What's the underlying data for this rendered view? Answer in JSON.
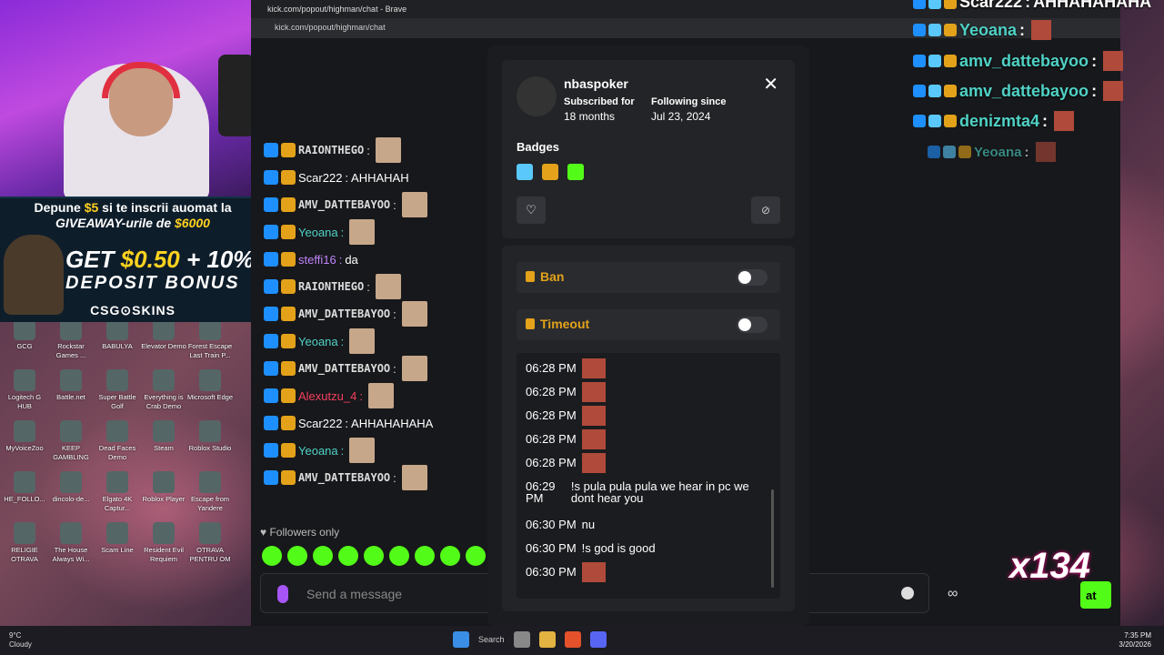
{
  "desktop": {
    "icons": [
      {
        "label": "GCG",
        "icon": "app-icon"
      },
      {
        "label": "Rockstar Games ...",
        "icon": "app-icon"
      },
      {
        "label": "BABULYA",
        "icon": "app-icon"
      },
      {
        "label": "Elevator Demo",
        "icon": "app-icon"
      },
      {
        "label": "Forest Escape Last Train P...",
        "icon": "app-icon"
      },
      {
        "label": "Logitech G HUB",
        "icon": "logitech-icon"
      },
      {
        "label": "Battle.net",
        "icon": "battlenet-icon"
      },
      {
        "label": "Super Battle Golf",
        "icon": "app-icon"
      },
      {
        "label": "Everything is Crab Demo",
        "icon": "app-icon"
      },
      {
        "label": "Microsoft Edge",
        "icon": "edge-icon"
      },
      {
        "label": "MyVoiceZoo",
        "icon": "app-icon"
      },
      {
        "label": "KEEP GAMBLING",
        "icon": "app-icon"
      },
      {
        "label": "Dead Faces Demo",
        "icon": "app-icon"
      },
      {
        "label": "Steam",
        "icon": "steam-icon"
      },
      {
        "label": "Roblox Studio",
        "icon": "roblox-icon"
      },
      {
        "label": "HE_FOLLO...",
        "icon": "folder-icon"
      },
      {
        "label": "dincolo-de...",
        "icon": "file-icon"
      },
      {
        "label": "Elgato 4K Captur...",
        "icon": "elgato-icon"
      },
      {
        "label": "Roblox Player",
        "icon": "roblox-icon"
      },
      {
        "label": "Escape from Yandere",
        "icon": "app-icon"
      },
      {
        "label": "RELIGIE OTRAVA",
        "icon": "file-icon"
      },
      {
        "label": "The House Always Wi...",
        "icon": "app-icon"
      },
      {
        "label": "Scam Line",
        "icon": "app-icon"
      },
      {
        "label": "Resident Evil Requiem",
        "icon": "app-icon"
      },
      {
        "label": "OTRAVA PENTRU OM",
        "icon": "file-icon"
      }
    ]
  },
  "promo": {
    "line1_pre": "Depune ",
    "line1_amt": "$5",
    "line1_post": " si te inscrii auomat la",
    "line2_pre": "GIVEAWAY-urile de ",
    "line2_amt": "$6000",
    "big1_pre": "GET ",
    "big1_amt": "$0.50",
    "big1_post": " + 10%",
    "big2": "DEPOSIT BONUS",
    "brand": "CSG⊙SKINS"
  },
  "browser": {
    "title": "kick.com/popout/highman/chat - Brave",
    "url": "kick.com/popout/highman/chat"
  },
  "chat": {
    "messages": [
      {
        "user": "RAIONTHEGO",
        "text": "",
        "style": "fancy",
        "color": "#dddddd"
      },
      {
        "user": "Scar222",
        "text": " AHHAHAH",
        "style": "normal",
        "color": "#ffffff"
      },
      {
        "user": "AMV_DATTEBAYOO",
        "text": "",
        "style": "fancy",
        "color": "#dddddd"
      },
      {
        "user": "Yeoana",
        "text": "",
        "style": "normal",
        "color": "#4fd1c5"
      },
      {
        "user": "steffi16",
        "text": " da",
        "style": "normal",
        "color": "#c084fc"
      },
      {
        "user": "RAIONTHEGO",
        "text": "",
        "style": "fancy",
        "color": "#dddddd"
      },
      {
        "user": "AMV_DATTEBAYOO",
        "text": "",
        "style": "fancy",
        "color": "#dddddd"
      },
      {
        "user": "Yeoana",
        "text": "",
        "style": "normal",
        "color": "#4fd1c5"
      },
      {
        "user": "AMV_DATTEBAYOO",
        "text": "",
        "style": "fancy",
        "color": "#dddddd"
      },
      {
        "user": "Alexutzu_4",
        "text": "",
        "style": "normal",
        "color": "#f43f5e"
      },
      {
        "user": "Scar222",
        "text": " AHHAHAHAHA",
        "style": "normal",
        "color": "#ffffff"
      },
      {
        "user": "Yeoana",
        "text": "",
        "style": "normal",
        "color": "#4fd1c5"
      },
      {
        "user": "AMV_DATTEBAYOO",
        "text": "",
        "style": "fancy",
        "color": "#dddddd"
      }
    ],
    "followers_only": "Followers only",
    "input_placeholder": "Send a message",
    "chat_button": "at",
    "infinity": "∞"
  },
  "modal": {
    "username": "nbaspoker",
    "subscribed_label": "Subscribed for",
    "subscribed_value": "18 months",
    "following_label": "Following since",
    "following_value": "Jul 23, 2024",
    "badges_title": "Badges",
    "ban_label": "Ban",
    "timeout_label": "Timeout",
    "log": [
      {
        "time": "06:28 PM",
        "text": "",
        "emote": true
      },
      {
        "time": "06:28 PM",
        "text": "",
        "emote": true
      },
      {
        "time": "06:28 PM",
        "text": "",
        "emote": true
      },
      {
        "time": "06:28 PM",
        "text": "",
        "emote": true
      },
      {
        "time": "06:28 PM",
        "text": "",
        "emote": true
      },
      {
        "time": "06:29 PM",
        "text": "!s pula pula pula we hear in pc we dont hear you",
        "emote": false
      },
      {
        "time": "06:30 PM",
        "text": "nu",
        "emote": false
      },
      {
        "time": "06:30 PM",
        "text": "!s god is good",
        "emote": false
      },
      {
        "time": "06:30 PM",
        "text": "",
        "emote": true
      }
    ]
  },
  "overlay": {
    "lines": [
      {
        "user": "Scar222",
        "sep": " : ",
        "text": "AHHAHAHAHA",
        "color": "#ffffff"
      },
      {
        "user": "Yeoana",
        "sep": " : ",
        "text": "",
        "color": "#4fd1c5"
      },
      {
        "user": "amv_dattebayoo",
        "sep": " : ",
        "text": "",
        "color": "#4fd1c5"
      },
      {
        "user": "amv_dattebayoo",
        "sep": " : ",
        "text": "",
        "color": "#4fd1c5"
      },
      {
        "user": "denizmta4",
        "sep": " : ",
        "text": "",
        "color": "#4fd1c5"
      },
      {
        "user": "Yeoana",
        "sep": " : ",
        "text": "",
        "color": "#4fd1c5"
      }
    ],
    "clap_count": "x134"
  },
  "taskbar": {
    "weather_temp": "9°C",
    "weather_desc": "Cloudy",
    "search": "Search",
    "time": "7:35 PM",
    "date": "3/20/2026"
  }
}
